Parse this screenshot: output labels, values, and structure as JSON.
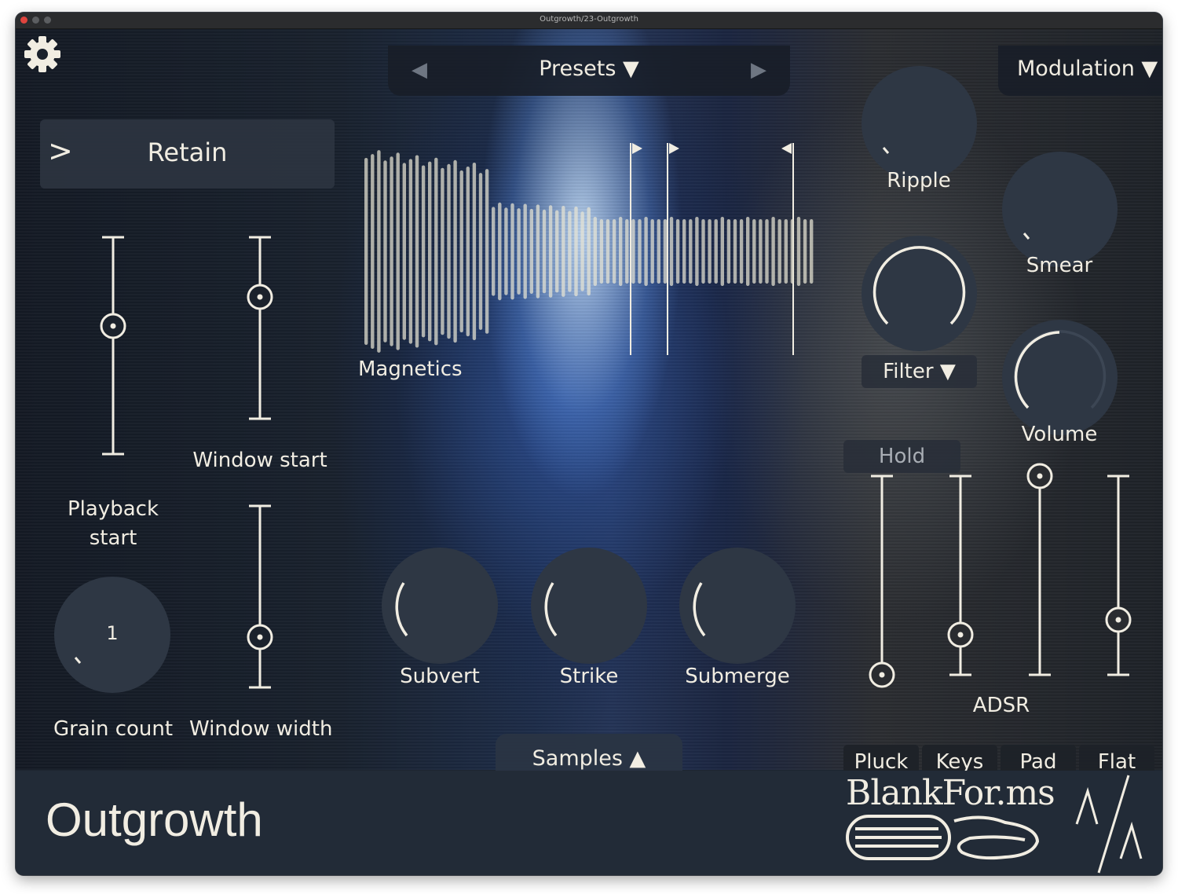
{
  "window": {
    "title": "Outgrowth/23-Outgrowth"
  },
  "toolbar": {
    "settings_icon": "gear-icon",
    "presets_label": "Presets ▼",
    "prev_icon": "triangle-left-icon",
    "next_icon": "triangle-right-icon",
    "modulation_label": "Modulation ▼"
  },
  "retain": {
    "chevron": ">",
    "label": "Retain"
  },
  "sliders": {
    "playback_start": {
      "label_line1": "Playback",
      "label_line2": "start",
      "value": 0.59
    },
    "window_start": {
      "label": "Window start",
      "value": 0.67
    },
    "window_width": {
      "label": "Window width",
      "value": 0.28
    }
  },
  "grain_count": {
    "label": "Grain count",
    "value": "1"
  },
  "waveform": {
    "label": "Magnetics"
  },
  "knobs": {
    "ripple": {
      "label": "Ripple"
    },
    "smear": {
      "label": "Smear"
    },
    "filter": {
      "label": "Filter ▼"
    },
    "volume": {
      "label": "Volume"
    },
    "subvert": {
      "label": "Subvert"
    },
    "strike": {
      "label": "Strike"
    },
    "submerge": {
      "label": "Submerge"
    }
  },
  "adsr": {
    "title": "ADSR",
    "hold_label": "Hold",
    "attack": 0.0,
    "decay": 0.2,
    "sustain": 1.0,
    "release": 0.28,
    "presets": [
      "Pluck",
      "Keys",
      "Pad",
      "Flat"
    ]
  },
  "samples": {
    "label": "Samples ▲"
  },
  "footer": {
    "app_name": "Outgrowth",
    "brand": "BlankFor.ms"
  }
}
